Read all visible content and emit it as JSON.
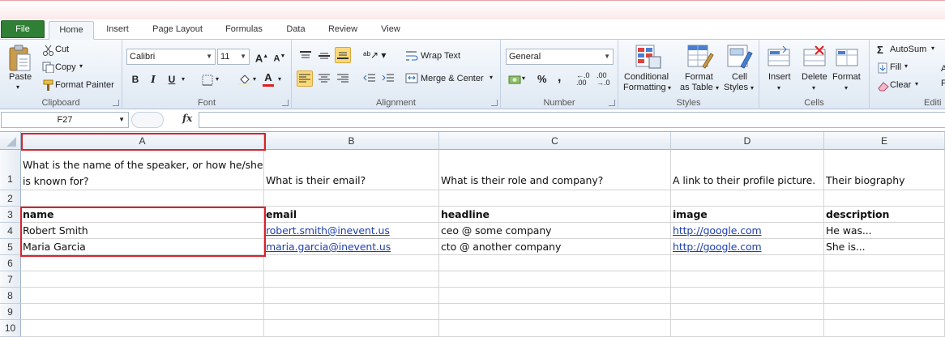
{
  "tabs": [
    "File",
    "Home",
    "Insert",
    "Page Layout",
    "Formulas",
    "Data",
    "Review",
    "View"
  ],
  "ribbon": {
    "clipboard": {
      "label": "Clipboard",
      "paste": "Paste",
      "cut": "Cut",
      "copy": "Copy",
      "format_painter": "Format Painter"
    },
    "font": {
      "label": "Font",
      "family": "Calibri",
      "size": "11",
      "bold": "B",
      "italic": "I",
      "underline": "U"
    },
    "alignment": {
      "label": "Alignment",
      "wrap_text": "Wrap Text",
      "merge_center": "Merge & Center"
    },
    "number": {
      "label": "Number",
      "format": "General",
      "percent": "%",
      "comma": ","
    },
    "styles": {
      "label": "Styles",
      "conditional_1": "Conditional",
      "conditional_2": "Formatting",
      "format_table_1": "Format",
      "format_table_2": "as Table",
      "cell_styles_1": "Cell",
      "cell_styles_2": "Styles"
    },
    "cells": {
      "label": "Cells",
      "insert": "Insert",
      "delete": "Delete",
      "format": "Format"
    },
    "editing": {
      "label": "Editi",
      "autosum": "AutoSum",
      "fill": "Fill",
      "clear": "Clear"
    }
  },
  "formula_bar": {
    "name_box": "F27",
    "fx": "fx",
    "value": ""
  },
  "columns": [
    "A",
    "B",
    "C",
    "D",
    "E"
  ],
  "rows": [
    "1",
    "2",
    "3",
    "4",
    "5",
    "6",
    "7",
    "8",
    "9",
    "10"
  ],
  "cells": {
    "A1": "What is the name of the speaker, or how he/she is known for?",
    "B1": "What is their email?",
    "C1": "What is their role and company?",
    "D1": "A link to their profile picture.",
    "E1": "Their biography",
    "A3": "name",
    "B3": "email",
    "C3": "headline",
    "D3": "image",
    "E3": "description",
    "A4": "Robert Smith",
    "B4": "robert.smith@inevent.us",
    "C4": "ceo @ some company",
    "D4": "http://google.com",
    "E4": "He was...",
    "A5": "Maria Garcia",
    "B5": "maria.garcia@inevent.us",
    "C5": "cto @ another company",
    "D5": "http://google.com",
    "E5": "She is..."
  },
  "colors": {
    "file_tab": "#2f7f35",
    "highlight_box": "#d9222a",
    "link": "#1f3fb0"
  }
}
